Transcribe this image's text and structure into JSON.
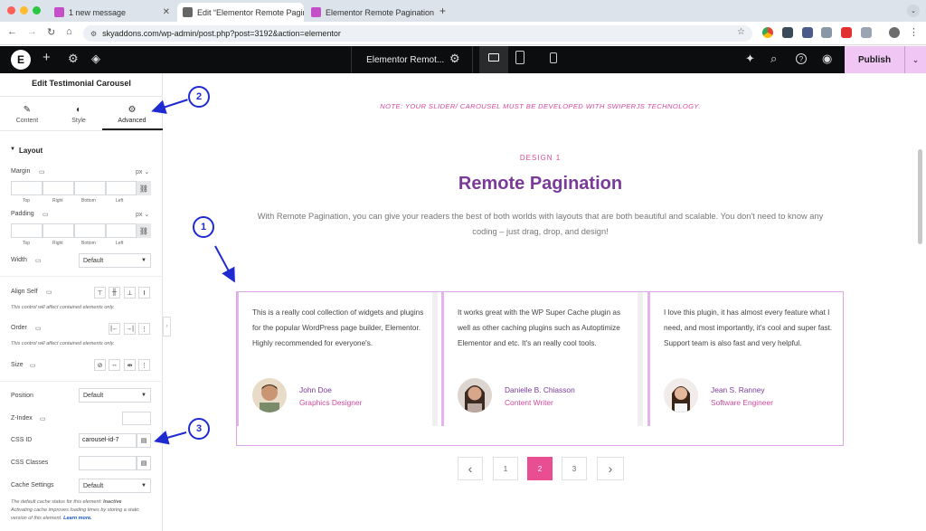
{
  "browser": {
    "tabs": [
      {
        "title": "1 new message",
        "favicon_color": "#c44fc8"
      },
      {
        "title": "Edit “Elementor Remote Pagin",
        "favicon_color": "#555555"
      },
      {
        "title": "Elementor Remote Pagination",
        "favicon_color": "#c44fc8"
      }
    ],
    "url": "skyaddons.com/wp-admin/post.php?post=3192&action=elementor"
  },
  "editor_bar": {
    "document_title": "Elementor Remot...",
    "publish_label": "Publish"
  },
  "panel": {
    "title": "Edit Testimonial Carousel",
    "tabs": [
      "Content",
      "Style",
      "Advanced"
    ],
    "active_tab": "Advanced",
    "section_title": "Layout",
    "margin": {
      "label": "Margin",
      "unit": "px",
      "sides": [
        "Top",
        "Right",
        "Bottom",
        "Left"
      ]
    },
    "padding": {
      "label": "Padding",
      "unit": "px",
      "sides": [
        "Top",
        "Right",
        "Bottom",
        "Left"
      ]
    },
    "width": {
      "label": "Width",
      "value": "Default"
    },
    "align_self": {
      "label": "Align Self",
      "note": "This control will affect contained elements only."
    },
    "order": {
      "label": "Order",
      "note": "This control will affect contained elements only."
    },
    "size": {
      "label": "Size"
    },
    "position": {
      "label": "Position",
      "value": "Default"
    },
    "zindex": {
      "label": "Z-Index",
      "value": ""
    },
    "css_id": {
      "label": "CSS ID",
      "value": "carousel-id-7"
    },
    "css_classes": {
      "label": "CSS Classes",
      "value": ""
    },
    "cache": {
      "label": "Cache Settings",
      "value": "Default",
      "note_prefix": "The default cache status for this element: ",
      "note_status": "Inactive",
      "note_body": "Activating cache improves loading times by storing a static version of this element.",
      "learn_more": "Learn more."
    }
  },
  "canvas": {
    "notice": "NOTE: YOUR SLIDER/ CAROUSEL MUST BE DEVELOPED WITH SWIPERJS TECHNOLOGY.",
    "eyebrow": "DESIGN 1",
    "heading": "Remote Pagination",
    "description_line1": "With Remote Pagination, you can give your readers the best of both worlds with layouts that are both beautiful and scalable. You don't need to know any",
    "description_line2": "coding – just drag, drop, and design!",
    "testimonials": [
      {
        "text": "This is a really cool collection of widgets and plugins for the popular WordPress page builder, Elementor. Highly recommended for everyone's.",
        "name": "John Doe",
        "role": "Graphics Designer"
      },
      {
        "text": "It works great with the WP Super Cache plugin as well as other caching plugins such as Autoptimize Elementor and etc. It's an really cool tools.",
        "name": "Danielle B. Chiasson",
        "role": "Content Writer"
      },
      {
        "text": "I love this plugin, it has almost every feature what I need, and most importantly, it's cool and super fast. Support team is also fast and very helpful.",
        "name": "Jean S. Ranney",
        "role": "Software Engineer"
      }
    ],
    "pagination": {
      "prev": "‹",
      "pages": [
        "1",
        "2",
        "3"
      ],
      "current": "2",
      "next": "›"
    }
  },
  "callouts": [
    "1",
    "2",
    "3"
  ],
  "colors": {
    "accent_purple": "#7a3a99",
    "accent_pink": "#d24b9c",
    "callout_blue": "#1f2bd1",
    "publish_bg": "#f0c6f5"
  }
}
